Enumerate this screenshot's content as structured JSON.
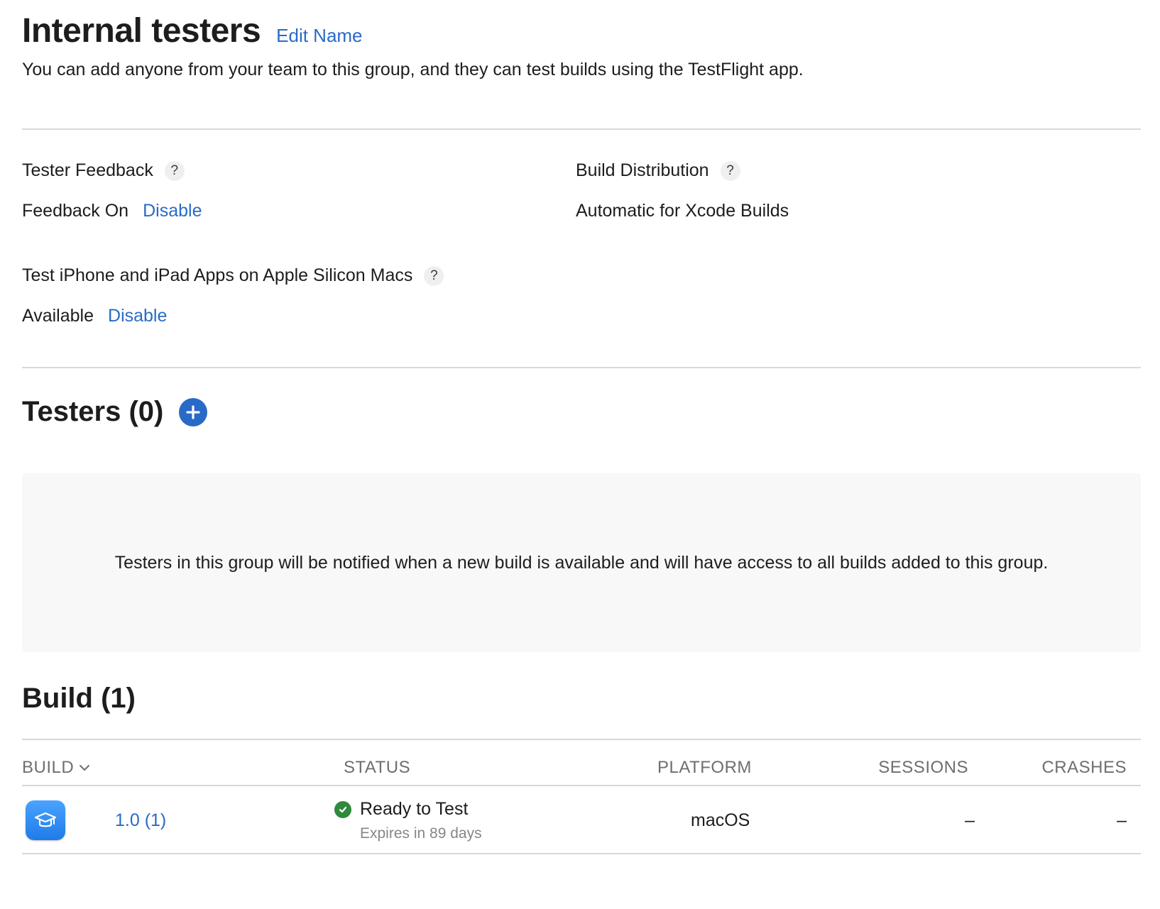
{
  "header": {
    "title": "Internal testers",
    "edit_name_label": "Edit Name",
    "subtitle": "You can add anyone from your team to this group, and they can test builds using the TestFlight app."
  },
  "settings": {
    "tester_feedback": {
      "label": "Tester Feedback",
      "value": "Feedback On",
      "action": "Disable"
    },
    "build_distribution": {
      "label": "Build Distribution",
      "value": "Automatic for Xcode Builds"
    },
    "apple_silicon": {
      "label": "Test iPhone and iPad Apps on Apple Silicon Macs",
      "value": "Available",
      "action": "Disable"
    },
    "help_glyph": "?"
  },
  "testers": {
    "title": "Testers (0)",
    "add_icon": "plus-circle-icon",
    "empty_message": "Testers in this group will be notified when a new build is available and will have access to all builds added to this group."
  },
  "builds": {
    "title": "Build (1)",
    "columns": [
      "BUILD",
      "STATUS",
      "PLATFORM",
      "SESSIONS",
      "CRASHES"
    ],
    "rows": [
      {
        "app_icon": "graduation-cap-icon",
        "version": "1.0 (1)",
        "status": "Ready to Test",
        "status_icon": "checkmark-circle-icon",
        "status_detail": "Expires in 89 days",
        "platform": "macOS",
        "sessions": "–",
        "crashes": "–"
      }
    ]
  },
  "colors": {
    "link": "#2a6ac7",
    "status_ok": "#2f8a3e",
    "divider": "#d8d8d8",
    "empty_bg": "#f8f8f8",
    "muted_text": "#86868b"
  }
}
